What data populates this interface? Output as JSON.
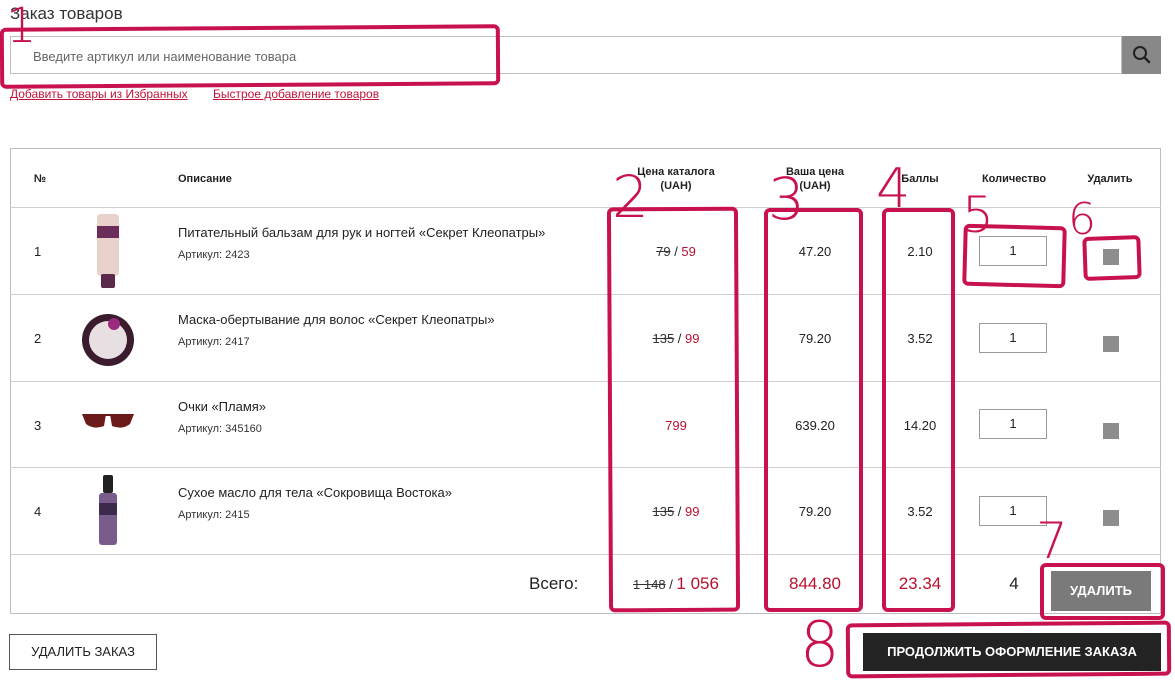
{
  "page": {
    "title": "Заказ товаров",
    "search_placeholder": "Введите артикул или наименование товара",
    "links": [
      "Добавить товары из Избранных",
      "Быстрое добавление товаров"
    ]
  },
  "table": {
    "headers": {
      "no": "№",
      "desc": "Описание",
      "catalog_price": "Цена каталога",
      "catalog_price_unit": "(UAH)",
      "your_price": "Ваша цена",
      "your_price_unit": "(UAH)",
      "points": "Баллы",
      "qty": "Количество",
      "delete": "Удалить"
    },
    "rows": [
      {
        "no": "1",
        "name": "Питательный бальзам для рук и ногтей «Секрет Клеопатры»",
        "article": "Артикул: 2423",
        "old_price": "79",
        "sep": " / ",
        "new_price": "59",
        "your_price": "47.20",
        "points": "2.10",
        "qty": "1"
      },
      {
        "no": "2",
        "name": "Маска-обертывание для волос «Секрет Клеопатры»",
        "article": "Артикул: 2417",
        "old_price": "135",
        "sep": " / ",
        "new_price": "99",
        "your_price": "79.20",
        "points": "3.52",
        "qty": "1"
      },
      {
        "no": "3",
        "name": "Очки «Пламя»",
        "article": "Артикул: 345160",
        "old_price": "",
        "sep": "",
        "new_price": "799",
        "your_price": "639.20",
        "points": "14.20",
        "qty": "1"
      },
      {
        "no": "4",
        "name": "Сухое масло для тела «Сокровища Востока»",
        "article": "Артикул: 2415",
        "old_price": "135",
        "sep": " / ",
        "new_price": "99",
        "your_price": "79.20",
        "points": "3.52",
        "qty": "1"
      }
    ],
    "totals": {
      "label": "Всего:",
      "old_price": "1 148",
      "sep": " / ",
      "new_price": "1 056",
      "your_price": "844.80",
      "points": "23.34",
      "qty": "4"
    }
  },
  "buttons": {
    "delete_order": "УДАЛИТЬ ЗАКАЗ",
    "remove": "УДАЛИТЬ",
    "continue": "ПРОДОЛЖИТЬ ОФОРМЛЕНИЕ ЗАКАЗА"
  },
  "annotations": [
    "1",
    "2",
    "3",
    "4",
    "5",
    "6",
    "7",
    "8"
  ],
  "colors": {
    "accent": "#c8124d",
    "price_red": "#b8102e",
    "button_dark": "#232323",
    "button_gray": "#7a7a7a"
  },
  "icons": [
    "search-icon"
  ]
}
